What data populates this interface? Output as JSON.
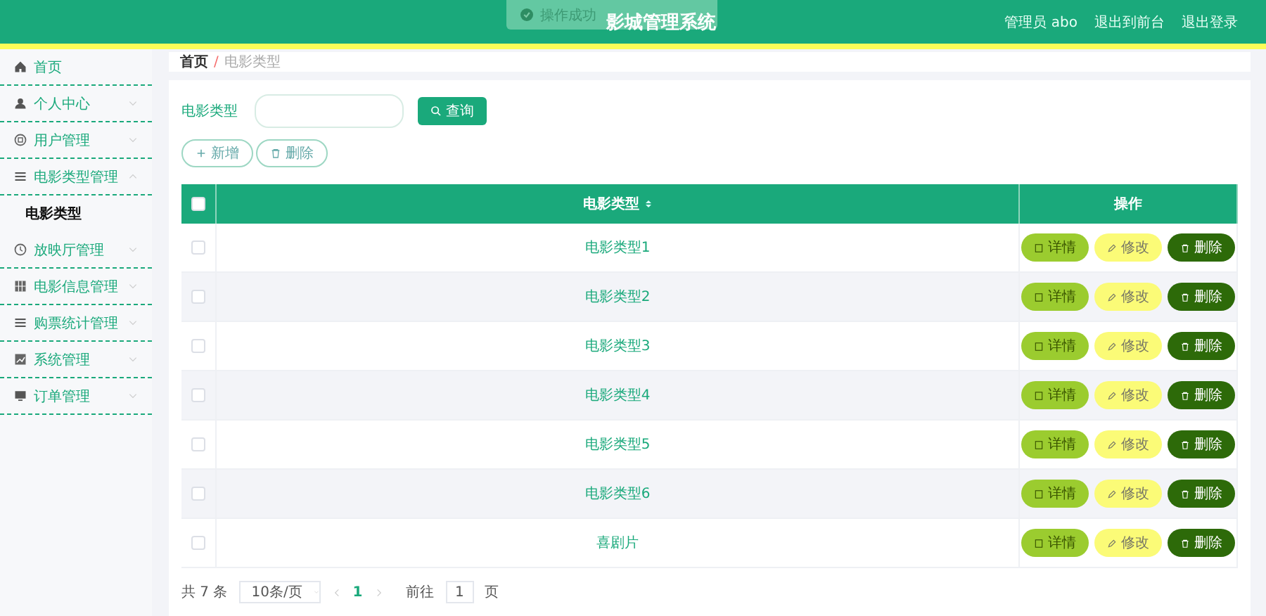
{
  "header": {
    "title": "影城管理系统",
    "links": [
      "管理员 abo",
      "退出到前台",
      "退出登录"
    ]
  },
  "toast": {
    "text": "操作成功"
  },
  "sidebar": {
    "items": [
      {
        "label": "首页"
      },
      {
        "label": "个人中心",
        "expanded": false
      },
      {
        "label": "用户管理",
        "expanded": false
      },
      {
        "label": "电影类型管理",
        "expanded": true,
        "children": [
          {
            "label": "电影类型",
            "selected": true
          }
        ]
      },
      {
        "label": "放映厅管理",
        "expanded": false
      },
      {
        "label": "电影信息管理",
        "expanded": false
      },
      {
        "label": "购票统计管理",
        "expanded": false
      },
      {
        "label": "系统管理",
        "expanded": false
      },
      {
        "label": "订单管理",
        "expanded": false
      }
    ]
  },
  "breadcrumb": {
    "items": [
      "首页",
      "电影类型"
    ],
    "separator": "/"
  },
  "search": {
    "label": "电影类型",
    "button": "查询"
  },
  "actions": [
    "新增",
    "删除"
  ],
  "table": {
    "all_checked": false,
    "columns": [
      "电影类型",
      "操作"
    ],
    "rows": [
      {
        "name": "电影类型1",
        "checked": false,
        "buttons": [
          "详情",
          "修改",
          "删除"
        ]
      },
      {
        "name": "电影类型2",
        "checked": false,
        "buttons": [
          "详情",
          "修改",
          "删除"
        ]
      },
      {
        "name": "电影类型3",
        "checked": false,
        "buttons": [
          "详情",
          "修改",
          "删除"
        ]
      },
      {
        "name": "电影类型4",
        "checked": false,
        "buttons": [
          "详情",
          "修改",
          "删除"
        ]
      },
      {
        "name": "电影类型5",
        "checked": false,
        "buttons": [
          "详情",
          "修改",
          "删除"
        ]
      },
      {
        "name": "电影类型6",
        "checked": false,
        "buttons": [
          "详情",
          "修改",
          "删除"
        ]
      },
      {
        "name": "喜剧片",
        "checked": false,
        "buttons": [
          "详情",
          "修改",
          "删除"
        ]
      }
    ]
  },
  "pagination": {
    "total": "共 7 条",
    "page_size": "10条/页",
    "pages": [
      {
        "label": "1",
        "selected": true
      }
    ],
    "goto_label": "前往",
    "goto_value": "1",
    "goto_suffix": "页"
  }
}
